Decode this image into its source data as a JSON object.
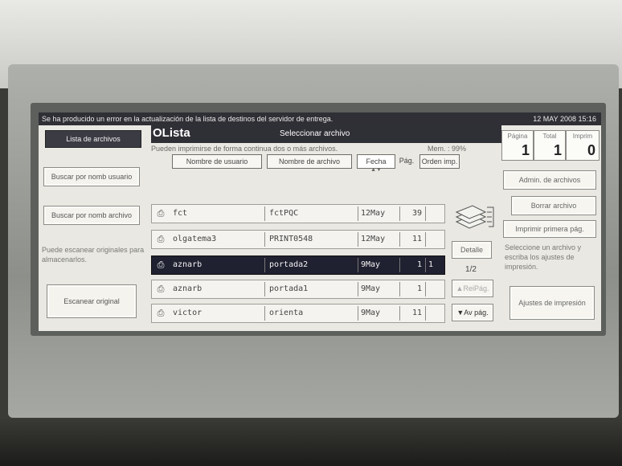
{
  "status": {
    "message": "Se ha producido un error en la actualización de la lista de destinos del servidor de entrega.",
    "datetime": "12 MAY   2008 15:16"
  },
  "left": {
    "file_list_label": "Lista de archivos",
    "search_user_label": "Buscar por nomb usuario",
    "search_file_label": "Buscar por nomb archivo",
    "note": "Puede escanear originales para almacenarlos.",
    "scan_label": "Escanear original"
  },
  "header": {
    "title": "OLista",
    "subtitle": "Seleccionar archivo",
    "info": "Pueden imprimirse de forma continua dos o más archivos.",
    "memory": "Mem. :  99%"
  },
  "columns": {
    "user": "Nombre de usuario",
    "file": "Nombre de archivo",
    "date": "Fecha",
    "pages": "Pág.",
    "order": "Orden imp."
  },
  "files": [
    {
      "icon": "user-printer-icon",
      "user": "fct",
      "file": "fctPQC",
      "date": "12May",
      "pages": "39",
      "order": ""
    },
    {
      "icon": "printer-icon",
      "user": "olgatema3",
      "file": "PRINT0548",
      "date": "12May",
      "pages": "11",
      "order": ""
    },
    {
      "icon": "printer-icon",
      "user": "aznarb",
      "file": "portada2",
      "date": "9May",
      "pages": "1",
      "order": "1",
      "selected": true
    },
    {
      "icon": "printer-icon",
      "user": "aznarb",
      "file": "portada1",
      "date": "9May",
      "pages": "1",
      "order": ""
    },
    {
      "icon": "printer-icon",
      "user": "victor",
      "file": "orienta",
      "date": "9May",
      "pages": "11",
      "order": ""
    }
  ],
  "pager": {
    "detail_label": "Detalle",
    "page": "1/2",
    "prev_label": "▲ReiPág.",
    "next_label": "▼Av pág."
  },
  "counters": {
    "page": {
      "label": "Página",
      "value": "1"
    },
    "total": {
      "label": "Total",
      "value": "1"
    },
    "print": {
      "label": "Imprim",
      "value": "0"
    }
  },
  "right": {
    "admin_label": "Admin. de archivos",
    "delete_label": "Borrar archivo",
    "print_first_label": "Imprimir primera pág.",
    "note": "Seleccione un archivo y escriba los ajustes de impresión.",
    "settings_label": "Ajustes de impresión"
  }
}
